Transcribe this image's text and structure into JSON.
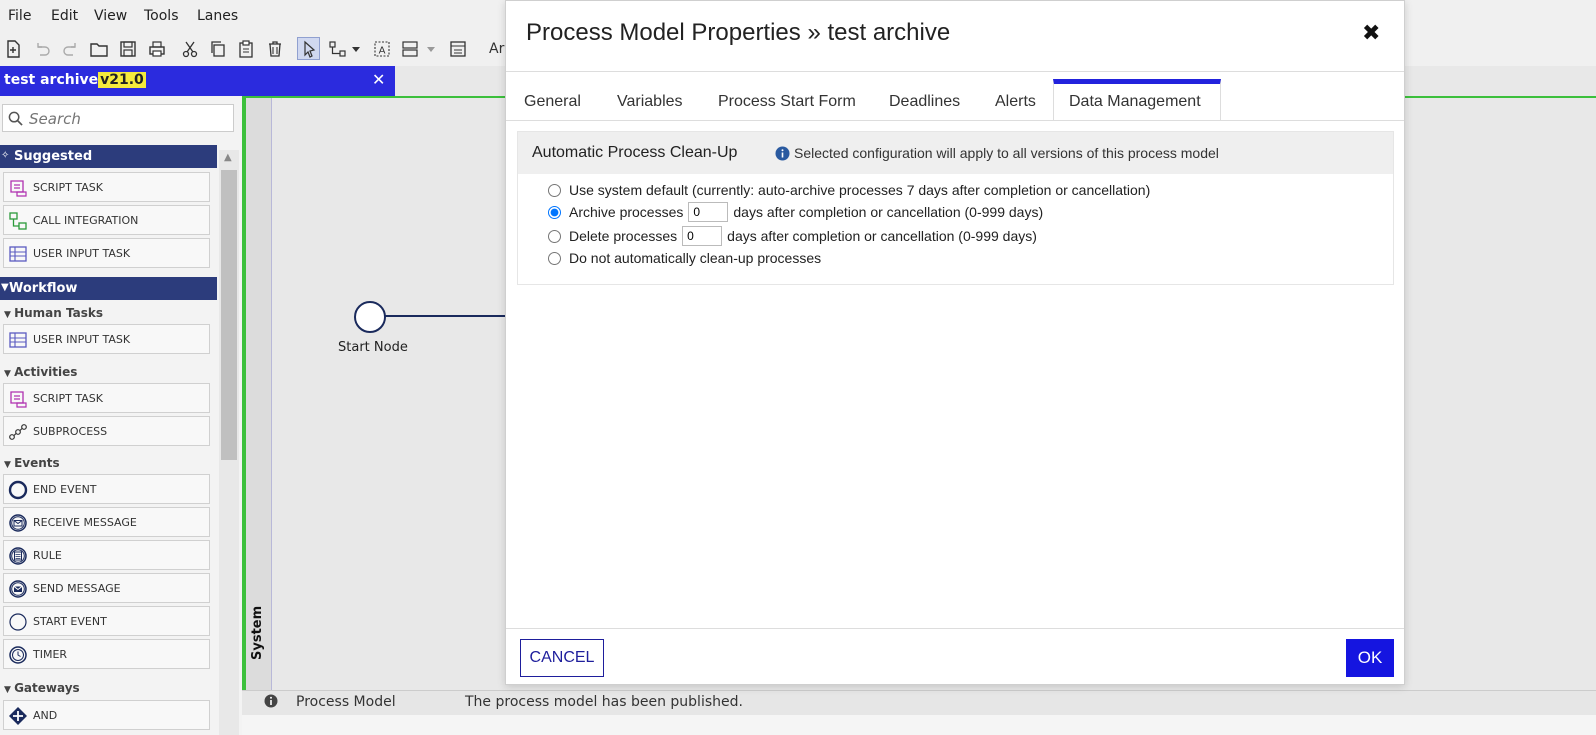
{
  "menubar": {
    "items": [
      "File",
      "Edit",
      "View",
      "Tools",
      "Lanes"
    ]
  },
  "toolbar": {
    "truncated_text": "Ar",
    "icons": [
      "new-icon",
      "undo-icon",
      "redo-icon",
      "open-folder-icon",
      "save-icon",
      "print-icon",
      "cut-icon",
      "copy-icon",
      "paste-icon",
      "delete-icon",
      "select-pointer-icon",
      "connector-icon",
      "text-annotation-icon",
      "lanes-icon",
      "properties-icon"
    ]
  },
  "document_tab": {
    "title": "test archive",
    "version": "v21.0",
    "close": "✕"
  },
  "palette": {
    "search_placeholder": "Search",
    "suggested": {
      "label": "Suggested",
      "items": [
        "SCRIPT TASK",
        "CALL INTEGRATION",
        "USER INPUT TASK"
      ]
    },
    "workflow": {
      "label": "Workflow",
      "human_tasks": {
        "label": "Human Tasks",
        "items": [
          "USER INPUT TASK"
        ]
      },
      "activities": {
        "label": "Activities",
        "items": [
          "SCRIPT TASK",
          "SUBPROCESS"
        ]
      },
      "events": {
        "label": "Events",
        "items": [
          "END EVENT",
          "RECEIVE MESSAGE",
          "RULE",
          "SEND MESSAGE",
          "START EVENT",
          "TIMER"
        ]
      },
      "gateways": {
        "label": "Gateways",
        "items": [
          "AND"
        ]
      }
    }
  },
  "canvas": {
    "lane_label": "System",
    "start_node_label": "Start Node"
  },
  "statusbar": {
    "label": "Process Model",
    "message": "The process model has been published."
  },
  "dialog": {
    "title": "Process Model Properties » test archive",
    "close": "✖",
    "tabs": [
      "General",
      "Variables",
      "Process Start Form",
      "Deadlines",
      "Alerts",
      "Data Management"
    ],
    "active_tab": "Data Management",
    "section": {
      "title": "Automatic Process Clean-Up",
      "note": "Selected configuration will apply to all versions of this process model",
      "options": {
        "system_default": "Use system default (currently: auto-archive processes 7 days after completion or cancellation)",
        "archive_prefix": "Archive processes",
        "archive_value": "0",
        "archive_suffix": "days after completion or cancellation (0-999 days)",
        "delete_prefix": "Delete processes",
        "delete_value": "0",
        "delete_suffix": "days after completion or cancellation (0-999 days)",
        "no_cleanup": "Do not automatically clean-up processes"
      },
      "selected_option": "archive"
    },
    "cancel_label": "CANCEL",
    "ok_label": "OK"
  },
  "colors": {
    "accent": "#2222dd",
    "palette_header": "#2c3c7c",
    "lane_border": "#3cc03c",
    "version_highlight": "#f5ea3c"
  }
}
